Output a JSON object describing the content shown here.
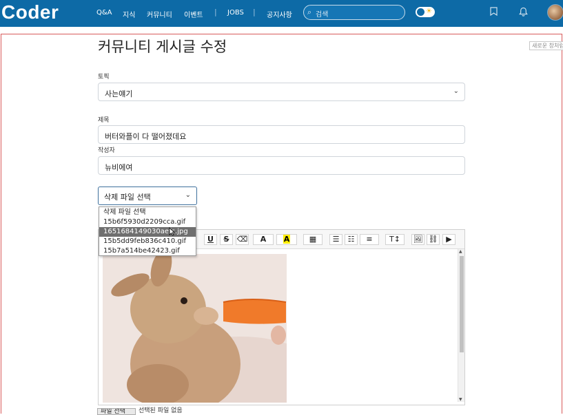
{
  "header": {
    "logo": "Coder",
    "nav": [
      "Q&A",
      "지식",
      "커뮤니티",
      "이벤트",
      "JOBS",
      "공지사항"
    ],
    "search_placeholder": "검색",
    "icons": [
      "bookmark-icon",
      "bell-icon",
      "avatar"
    ]
  },
  "tooltip": "새로운 창처럼",
  "page": {
    "title": "커뮤니티 게시글 수정",
    "topic_label": "토픽",
    "topic_value": "사는얘기",
    "title_label": "제목",
    "title_value": "버터와플이 다 떨어졌데요",
    "author_label": "작성자",
    "author_value": "뉴비에여",
    "delete_select_value": "삭제 파일 선택",
    "delete_options": [
      "삭제 파일 선택",
      "15b6f5930d2209cca.gif",
      "1651684149030aefc.jpg",
      "15b5dd9feb836c410.gif",
      "15b7a514be42423.gif"
    ],
    "delete_selected_index": 2,
    "file_button": "파일 선택",
    "file_status": "선택된 파일 없음"
  },
  "editor_toolbar": {
    "underline": "U",
    "strike": "S",
    "eraser": "⌫",
    "font_color": "A",
    "highlight": "A",
    "table": "▦",
    "bullets": "☰",
    "numbered": "☷",
    "align": "≡",
    "textsize": "T↕",
    "image": "🖼",
    "link": "⛓",
    "video": "▶"
  },
  "colors": {
    "header_bg": "#0d6aa6",
    "frame": "#d85a5a",
    "selected_option": "#6f6f6f"
  }
}
